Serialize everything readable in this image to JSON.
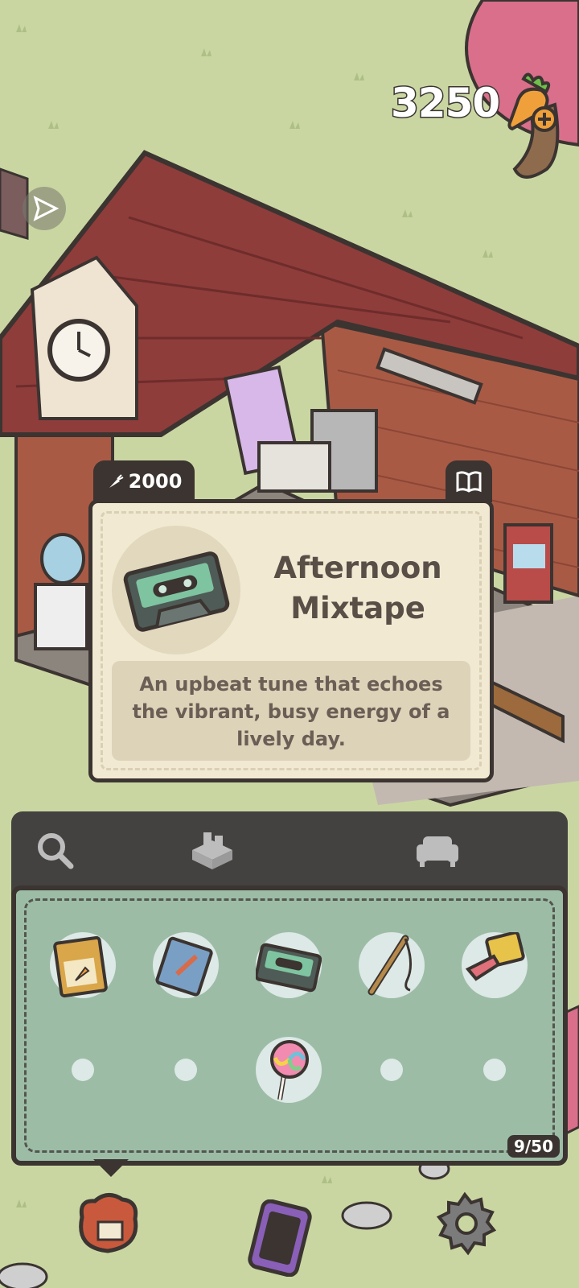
{
  "hud": {
    "carrots": "3250",
    "carrot_icon": "carrot-plus-icon"
  },
  "item_card": {
    "price": "2000",
    "price_icon": "carrot-small-icon",
    "title": "Afternoon Mixtape",
    "description": "An upbeat tune that echoes the vibrant, busy energy of a lively day.",
    "item_icon": "cassette-tape-icon",
    "book_icon": "book-icon"
  },
  "inventory": {
    "tabs": [
      {
        "icon": "magnifier-icon"
      },
      {
        "icon": "crafting-machine-icon"
      },
      {
        "icon": "sofa-icon"
      }
    ],
    "slots": [
      {
        "icon": "seed-packet-icon"
      },
      {
        "icon": "notepad-icon"
      },
      {
        "icon": "cassette-tape-icon"
      },
      {
        "icon": "fishing-rod-icon"
      },
      {
        "icon": "tape-measure-icon"
      },
      {
        "icon": ""
      },
      {
        "icon": ""
      },
      {
        "icon": "lollipop-icon"
      },
      {
        "icon": ""
      },
      {
        "icon": ""
      }
    ],
    "count": "9/50"
  },
  "bottom_bar": [
    {
      "icon": "sack-icon"
    },
    {
      "icon": "phone-icon"
    },
    {
      "icon": "gear-icon"
    }
  ],
  "colors": {
    "grass": "#c9d6a2",
    "panel_dark": "#3b3431",
    "inventory_green": "#9cbca6",
    "card_cream": "#f1e9d2"
  }
}
